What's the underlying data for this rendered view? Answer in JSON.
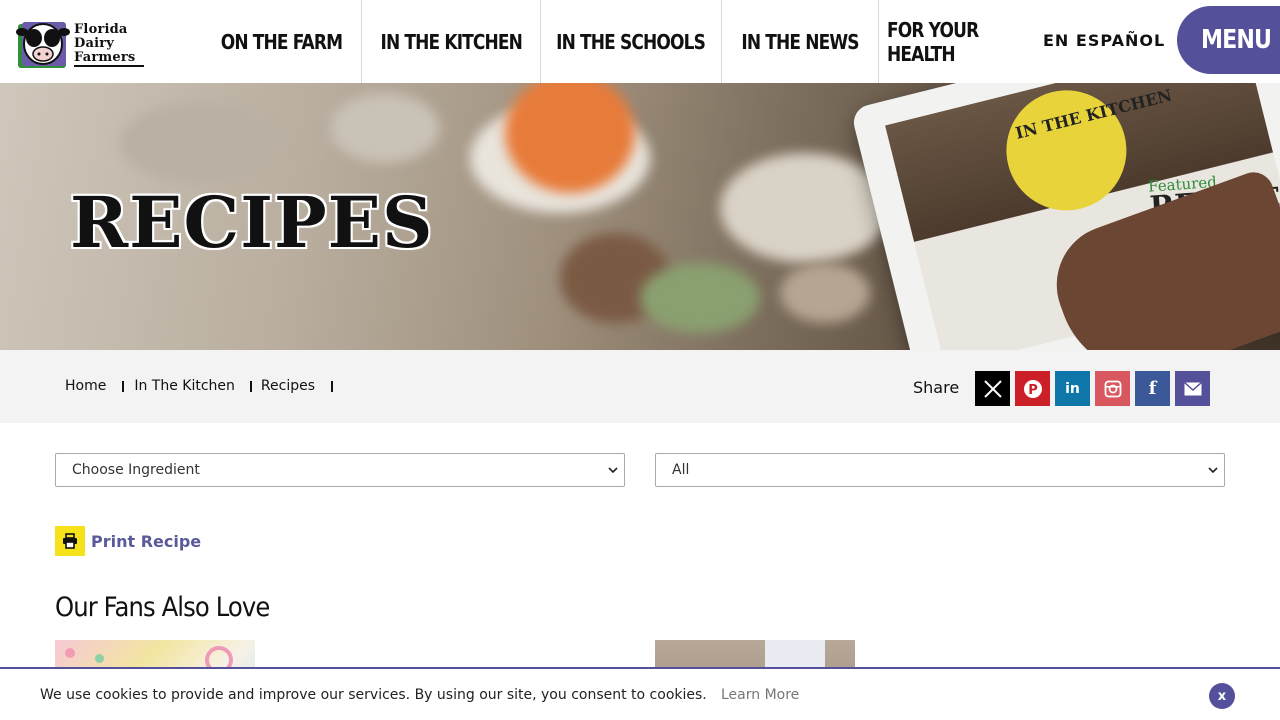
{
  "brand": {
    "line1": "Florida",
    "line2": "Dairy",
    "line3": "Farmers"
  },
  "nav": {
    "items": [
      "On the Farm",
      "In the Kitchen",
      "In the Schools",
      "In the News",
      "For Your Health"
    ],
    "espanol": "EN ESPAÑOL",
    "menu": "MENU"
  },
  "hero": {
    "title": "RECIPES",
    "tablet_badge": "IN THE KITCHEN",
    "tablet_featured": "Featured",
    "tablet_recipe": "RECIPE"
  },
  "breadcrumb": [
    "Home",
    "In The Kitchen",
    "Recipes"
  ],
  "share": {
    "label": "Share",
    "networks": [
      {
        "name": "x",
        "glyph": "X",
        "color": "#000000"
      },
      {
        "name": "pinterest",
        "glyph": "P",
        "color": "#cb2027"
      },
      {
        "name": "linkedin",
        "glyph": "in",
        "color": "#0e76a8"
      },
      {
        "name": "instagram",
        "glyph": "◎",
        "color": "#d9575f"
      },
      {
        "name": "facebook",
        "glyph": "f",
        "color": "#3b5998"
      },
      {
        "name": "email",
        "glyph": "✉",
        "color": "#55509a"
      }
    ]
  },
  "filters": {
    "ingredient": "Choose Ingredient",
    "category": "All"
  },
  "print": {
    "label": "Print Recipe"
  },
  "section": {
    "title": "Our Fans Also Love"
  },
  "cookie": {
    "text": "We use cookies to provide and improve our services. By using our site, you consent to cookies.",
    "link": "Learn More",
    "close": "x"
  },
  "colors": {
    "accent": "#55509a",
    "print_yellow": "#f5e21a"
  }
}
